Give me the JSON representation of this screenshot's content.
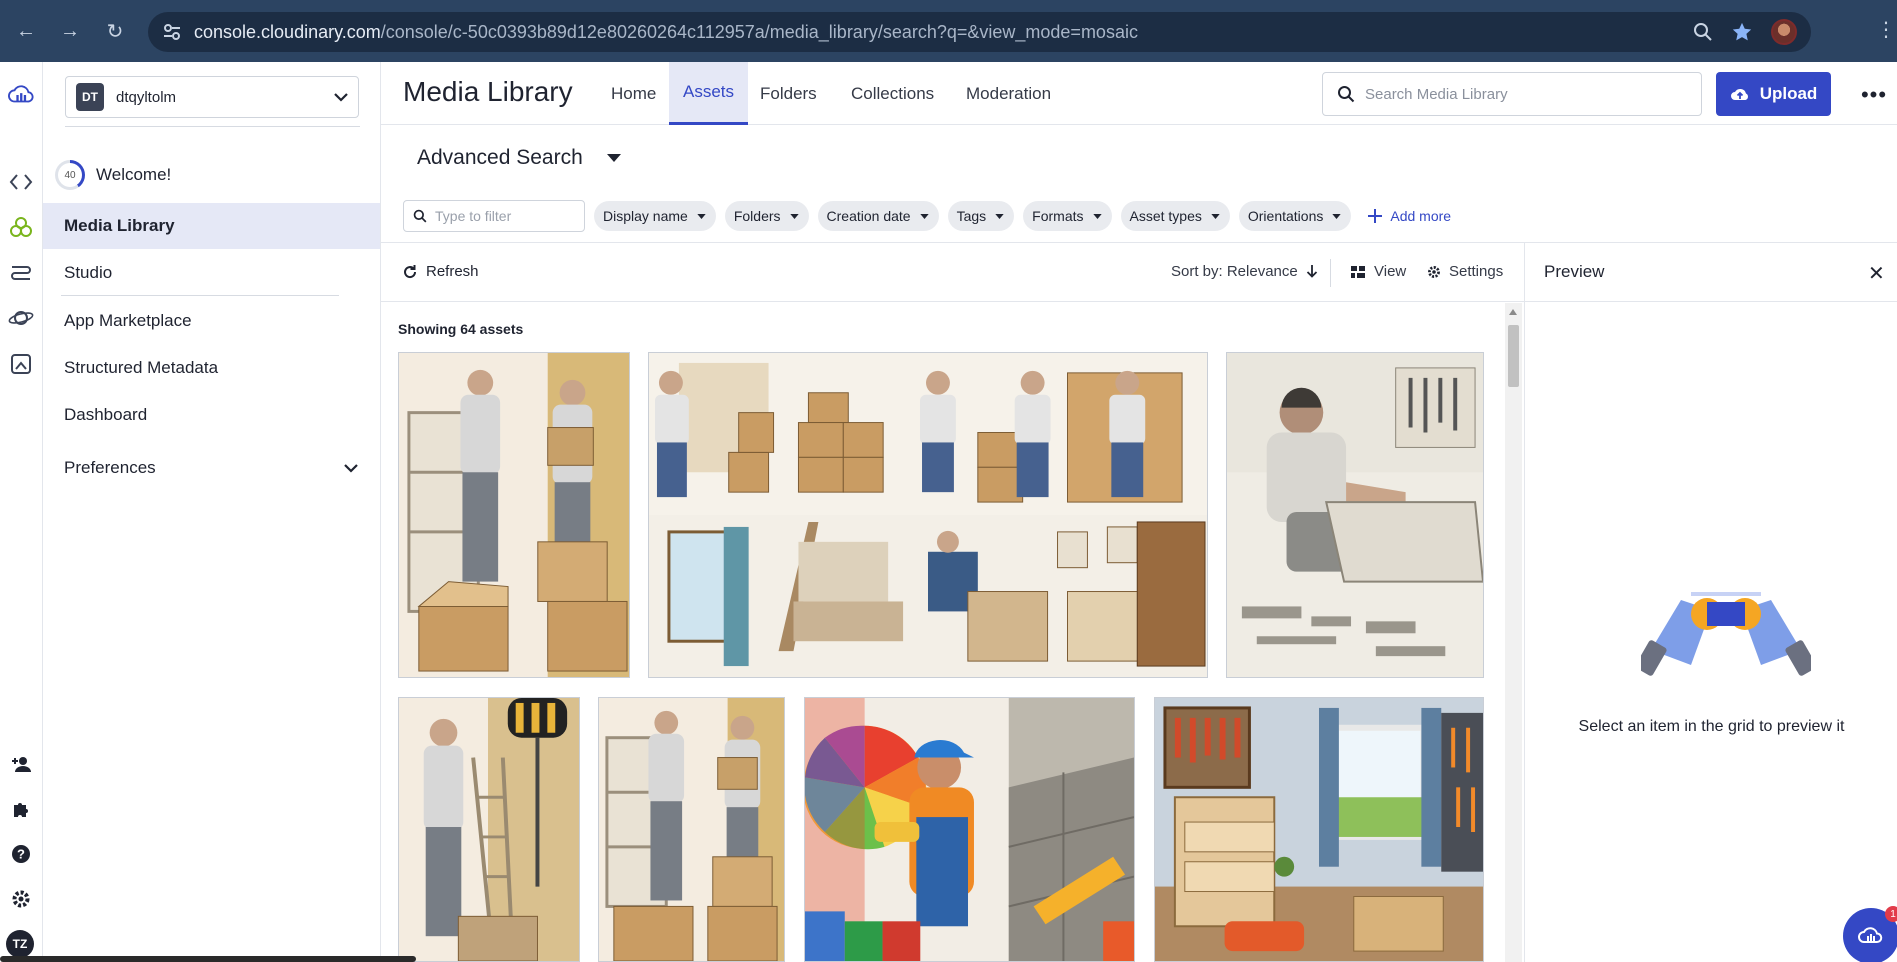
{
  "browser": {
    "url_host": "console.cloudinary.com",
    "url_path": "/console/c-50c0393b89d12e80260264c112957a/media_library/search?q=&view_mode=mosaic"
  },
  "rail": {
    "icons": [
      "cloudinary-logo-icon",
      "code-brackets-icon",
      "assets-icon",
      "video-icon",
      "planet-icon",
      "transform-icon"
    ],
    "bottom_icons": [
      "add-user-icon",
      "puzzle-icon",
      "help-icon",
      "gear-icon"
    ],
    "user_initials": "TZ"
  },
  "sidebar": {
    "cloud_badge": "DT",
    "cloud_name": "dtqyltolm",
    "welcome_progress": "40",
    "welcome_label": "Welcome!",
    "items": [
      {
        "label": "Media Library",
        "active": true
      },
      {
        "label": "Studio"
      },
      {
        "label": "App Marketplace"
      },
      {
        "label": "Structured Metadata"
      },
      {
        "label": "Dashboard"
      },
      {
        "label": "Preferences"
      }
    ]
  },
  "header": {
    "title": "Media Library",
    "tabs": [
      "Home",
      "Assets",
      "Folders",
      "Collections",
      "Moderation"
    ],
    "active_tab": "Assets",
    "search_placeholder": "Search Media Library",
    "upload_label": "Upload"
  },
  "search": {
    "title": "Advanced Search",
    "filter_placeholder": "Type to filter",
    "chips": [
      "Display name",
      "Folders",
      "Creation date",
      "Tags",
      "Formats",
      "Asset types",
      "Orientations"
    ],
    "add_more": "Add more"
  },
  "toolbar": {
    "refresh": "Refresh",
    "sort": "Sort by: Relevance",
    "view": "View",
    "settings": "Settings"
  },
  "grid": {
    "showing": "Showing 64 assets"
  },
  "preview": {
    "title": "Preview",
    "message": "Select an item in the grid to preview it"
  },
  "chat": {
    "badge": "1"
  },
  "colors": {
    "accent": "#3448c5",
    "accent_light": "#e5e8f6",
    "browser_bar": "#2c4462"
  }
}
